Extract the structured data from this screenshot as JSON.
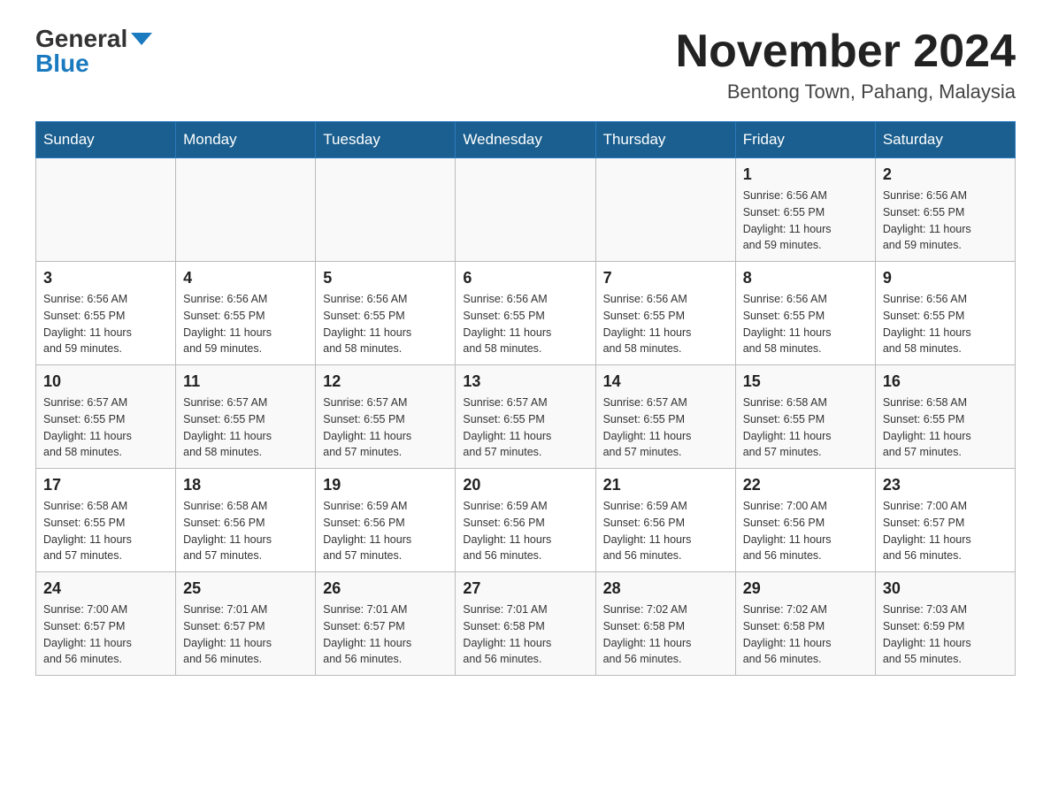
{
  "header": {
    "logo_general": "General",
    "logo_blue": "Blue",
    "month_title": "November 2024",
    "location": "Bentong Town, Pahang, Malaysia"
  },
  "weekdays": [
    "Sunday",
    "Monday",
    "Tuesday",
    "Wednesday",
    "Thursday",
    "Friday",
    "Saturday"
  ],
  "weeks": [
    {
      "days": [
        {
          "num": "",
          "info": ""
        },
        {
          "num": "",
          "info": ""
        },
        {
          "num": "",
          "info": ""
        },
        {
          "num": "",
          "info": ""
        },
        {
          "num": "",
          "info": ""
        },
        {
          "num": "1",
          "info": "Sunrise: 6:56 AM\nSunset: 6:55 PM\nDaylight: 11 hours\nand 59 minutes."
        },
        {
          "num": "2",
          "info": "Sunrise: 6:56 AM\nSunset: 6:55 PM\nDaylight: 11 hours\nand 59 minutes."
        }
      ]
    },
    {
      "days": [
        {
          "num": "3",
          "info": "Sunrise: 6:56 AM\nSunset: 6:55 PM\nDaylight: 11 hours\nand 59 minutes."
        },
        {
          "num": "4",
          "info": "Sunrise: 6:56 AM\nSunset: 6:55 PM\nDaylight: 11 hours\nand 59 minutes."
        },
        {
          "num": "5",
          "info": "Sunrise: 6:56 AM\nSunset: 6:55 PM\nDaylight: 11 hours\nand 58 minutes."
        },
        {
          "num": "6",
          "info": "Sunrise: 6:56 AM\nSunset: 6:55 PM\nDaylight: 11 hours\nand 58 minutes."
        },
        {
          "num": "7",
          "info": "Sunrise: 6:56 AM\nSunset: 6:55 PM\nDaylight: 11 hours\nand 58 minutes."
        },
        {
          "num": "8",
          "info": "Sunrise: 6:56 AM\nSunset: 6:55 PM\nDaylight: 11 hours\nand 58 minutes."
        },
        {
          "num": "9",
          "info": "Sunrise: 6:56 AM\nSunset: 6:55 PM\nDaylight: 11 hours\nand 58 minutes."
        }
      ]
    },
    {
      "days": [
        {
          "num": "10",
          "info": "Sunrise: 6:57 AM\nSunset: 6:55 PM\nDaylight: 11 hours\nand 58 minutes."
        },
        {
          "num": "11",
          "info": "Sunrise: 6:57 AM\nSunset: 6:55 PM\nDaylight: 11 hours\nand 58 minutes."
        },
        {
          "num": "12",
          "info": "Sunrise: 6:57 AM\nSunset: 6:55 PM\nDaylight: 11 hours\nand 57 minutes."
        },
        {
          "num": "13",
          "info": "Sunrise: 6:57 AM\nSunset: 6:55 PM\nDaylight: 11 hours\nand 57 minutes."
        },
        {
          "num": "14",
          "info": "Sunrise: 6:57 AM\nSunset: 6:55 PM\nDaylight: 11 hours\nand 57 minutes."
        },
        {
          "num": "15",
          "info": "Sunrise: 6:58 AM\nSunset: 6:55 PM\nDaylight: 11 hours\nand 57 minutes."
        },
        {
          "num": "16",
          "info": "Sunrise: 6:58 AM\nSunset: 6:55 PM\nDaylight: 11 hours\nand 57 minutes."
        }
      ]
    },
    {
      "days": [
        {
          "num": "17",
          "info": "Sunrise: 6:58 AM\nSunset: 6:55 PM\nDaylight: 11 hours\nand 57 minutes."
        },
        {
          "num": "18",
          "info": "Sunrise: 6:58 AM\nSunset: 6:56 PM\nDaylight: 11 hours\nand 57 minutes."
        },
        {
          "num": "19",
          "info": "Sunrise: 6:59 AM\nSunset: 6:56 PM\nDaylight: 11 hours\nand 57 minutes."
        },
        {
          "num": "20",
          "info": "Sunrise: 6:59 AM\nSunset: 6:56 PM\nDaylight: 11 hours\nand 56 minutes."
        },
        {
          "num": "21",
          "info": "Sunrise: 6:59 AM\nSunset: 6:56 PM\nDaylight: 11 hours\nand 56 minutes."
        },
        {
          "num": "22",
          "info": "Sunrise: 7:00 AM\nSunset: 6:56 PM\nDaylight: 11 hours\nand 56 minutes."
        },
        {
          "num": "23",
          "info": "Sunrise: 7:00 AM\nSunset: 6:57 PM\nDaylight: 11 hours\nand 56 minutes."
        }
      ]
    },
    {
      "days": [
        {
          "num": "24",
          "info": "Sunrise: 7:00 AM\nSunset: 6:57 PM\nDaylight: 11 hours\nand 56 minutes."
        },
        {
          "num": "25",
          "info": "Sunrise: 7:01 AM\nSunset: 6:57 PM\nDaylight: 11 hours\nand 56 minutes."
        },
        {
          "num": "26",
          "info": "Sunrise: 7:01 AM\nSunset: 6:57 PM\nDaylight: 11 hours\nand 56 minutes."
        },
        {
          "num": "27",
          "info": "Sunrise: 7:01 AM\nSunset: 6:58 PM\nDaylight: 11 hours\nand 56 minutes."
        },
        {
          "num": "28",
          "info": "Sunrise: 7:02 AM\nSunset: 6:58 PM\nDaylight: 11 hours\nand 56 minutes."
        },
        {
          "num": "29",
          "info": "Sunrise: 7:02 AM\nSunset: 6:58 PM\nDaylight: 11 hours\nand 56 minutes."
        },
        {
          "num": "30",
          "info": "Sunrise: 7:03 AM\nSunset: 6:59 PM\nDaylight: 11 hours\nand 55 minutes."
        }
      ]
    }
  ]
}
